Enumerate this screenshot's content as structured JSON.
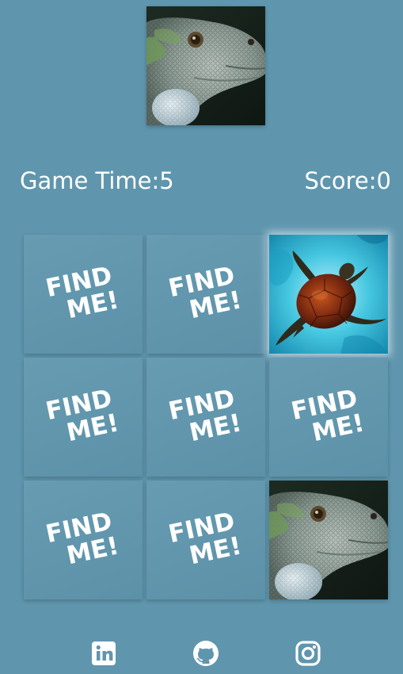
{
  "target": {
    "image": "iguana",
    "icon": "iguana-image"
  },
  "stats": {
    "time_label": "Game Time:",
    "time_value": "5",
    "score_label": "Score:",
    "score_value": "0"
  },
  "card_back_text": {
    "line1": "FIND",
    "line2": "ME!"
  },
  "cards": [
    {
      "state": "hidden",
      "label1": "FIND",
      "label2": "ME!"
    },
    {
      "state": "hidden",
      "label1": "FIND",
      "label2": "ME!"
    },
    {
      "state": "revealed",
      "image": "turtle"
    },
    {
      "state": "hidden",
      "label1": "FIND",
      "label2": "ME!"
    },
    {
      "state": "hidden",
      "label1": "FIND",
      "label2": "ME!"
    },
    {
      "state": "hidden",
      "label1": "FIND",
      "label2": "ME!"
    },
    {
      "state": "hidden",
      "label1": "FIND",
      "label2": "ME!"
    },
    {
      "state": "hidden",
      "label1": "FIND",
      "label2": "ME!"
    },
    {
      "state": "revealed",
      "image": "iguana"
    }
  ],
  "footer": {
    "links": [
      {
        "icon": "linkedin-icon"
      },
      {
        "icon": "github-icon"
      },
      {
        "icon": "instagram-icon"
      }
    ]
  },
  "colors": {
    "background": "#5f96ae",
    "text": "#ffffff"
  }
}
